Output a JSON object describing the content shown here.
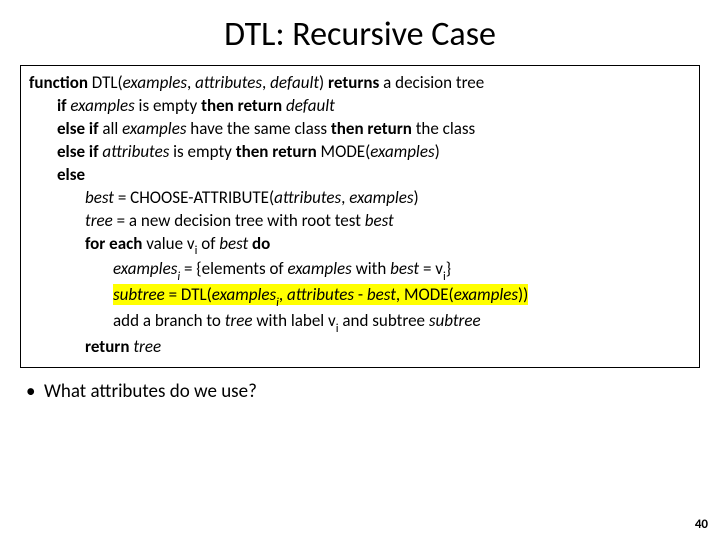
{
  "title": "DTL: Recursive Case",
  "algo": {
    "l1": {
      "a": "function",
      "b": " DTL(",
      "c": "examples",
      "d": ", ",
      "e": "attributes",
      "f": ", ",
      "g": "default",
      "h": ") ",
      "i": "returns",
      "j": " a decision tree"
    },
    "l2": {
      "a": "if ",
      "b": "examples",
      "c": " is empty ",
      "d": "then return ",
      "e": "default"
    },
    "l3": {
      "a": "else if ",
      "b": "all ",
      "c": "examples",
      "d": " have the same class ",
      "e": "then return ",
      "f": "the class"
    },
    "l4": {
      "a": "else if ",
      "b": "attributes",
      "c": " is empty ",
      "d": "then return ",
      "e": "MODE(",
      "f": "examples",
      "g": ")"
    },
    "l5": {
      "a": "else"
    },
    "l6": {
      "a": "best",
      "b": " = CHOOSE-ATTRIBUTE(",
      "c": "attributes",
      "d": ", ",
      "e": "examples",
      "f": ")"
    },
    "l7": {
      "a": "tree",
      "b": " = a new decision tree with root test ",
      "c": "best"
    },
    "l8": {
      "a": "for each ",
      "b": "value v",
      "sub": "i",
      "c": " of ",
      "d": "best",
      "e": " do"
    },
    "l9": {
      "a": "examples",
      "sub": "i",
      "b": " = {elements of ",
      "c": "examples",
      "d": " with ",
      "e": "best",
      "f": " = v",
      "sub2": "i",
      "g": "}"
    },
    "l10": {
      "a": "subtree",
      "b": " = DTL(",
      "c": "examples",
      "sub": "i",
      "d": ", ",
      "e": "attributes",
      "f": " - ",
      "g": "best",
      "h": ", MODE(",
      "i": "examples",
      "j": "))"
    },
    "l11": {
      "a": "add a branch to ",
      "b": "tree",
      "c": " with label v",
      "sub": "i",
      "d": " and subtree ",
      "e": "subtree"
    },
    "l12": {
      "a": "return ",
      "b": "tree"
    }
  },
  "bullet": "What attributes do we use?",
  "pagenum": "40"
}
